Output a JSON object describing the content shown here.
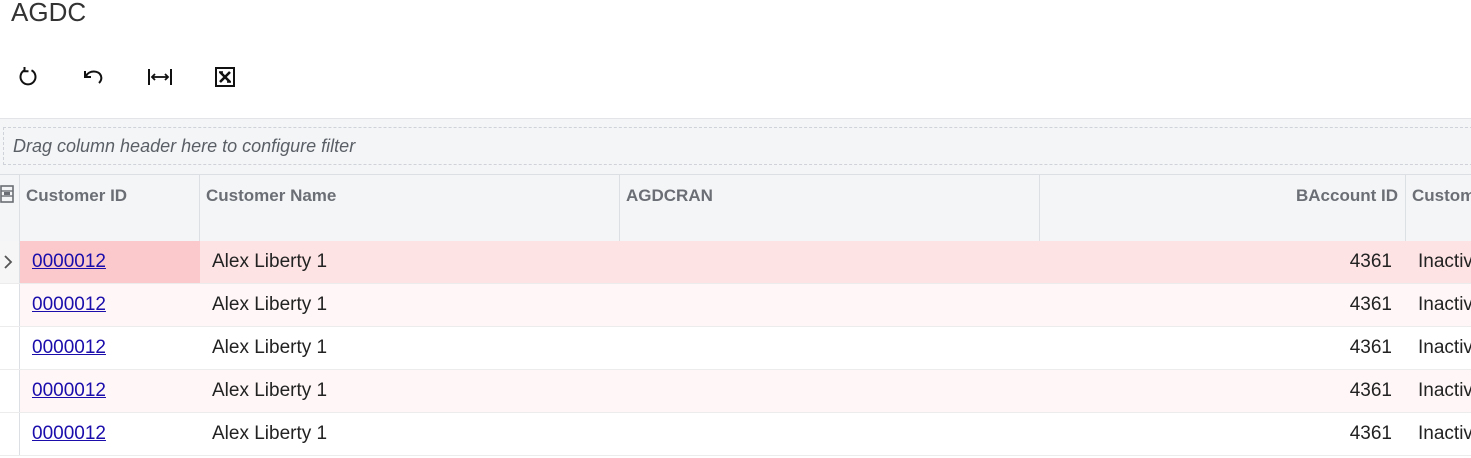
{
  "page": {
    "title": "AGDC"
  },
  "toolbar": {
    "buttons": [
      {
        "name": "refresh",
        "icon": "refresh-icon"
      },
      {
        "name": "undo",
        "icon": "undo-icon"
      },
      {
        "name": "fit-columns",
        "icon": "fit-width-icon"
      },
      {
        "name": "export-excel",
        "icon": "excel-icon"
      }
    ]
  },
  "filter": {
    "placeholder": "Drag column header here to configure filter"
  },
  "grid": {
    "columns": [
      {
        "key": "customer_id",
        "label": "Customer ID"
      },
      {
        "key": "customer_name",
        "label": "Customer Name"
      },
      {
        "key": "agdcran",
        "label": "AGDCRAN"
      },
      {
        "key": "baccount_id",
        "label": "BAccount ID"
      },
      {
        "key": "customer_status",
        "label": "Custom"
      }
    ],
    "rows": [
      {
        "customer_id": "0000012",
        "customer_name": "Alex Liberty 1",
        "agdcran": "",
        "baccount_id": "4361",
        "customer_status": "Inactiv"
      },
      {
        "customer_id": "0000012",
        "customer_name": "Alex Liberty 1",
        "agdcran": "",
        "baccount_id": "4361",
        "customer_status": "Inactiv"
      },
      {
        "customer_id": "0000012",
        "customer_name": "Alex Liberty 1",
        "agdcran": "",
        "baccount_id": "4361",
        "customer_status": "Inactiv"
      },
      {
        "customer_id": "0000012",
        "customer_name": "Alex Liberty 1",
        "agdcran": "",
        "baccount_id": "4361",
        "customer_status": "Inactiv"
      },
      {
        "customer_id": "0000012",
        "customer_name": "Alex Liberty 1",
        "agdcran": "",
        "baccount_id": "4361",
        "customer_status": "Inactiv"
      }
    ]
  },
  "colors": {
    "selected_row": "#fde3e4",
    "selected_cell": "#fbc9cb",
    "link": "#1a0dab",
    "header_bg": "#f4f5f7"
  }
}
